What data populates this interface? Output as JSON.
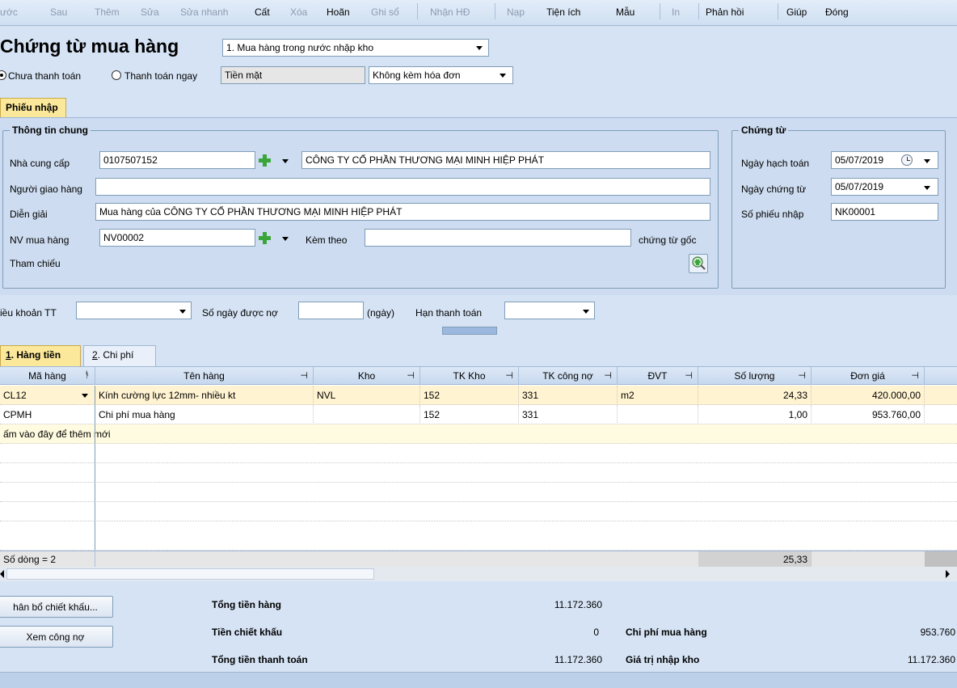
{
  "toolbar": {
    "items": [
      "ước",
      "Sau",
      "Thêm",
      "Sửa",
      "Sửa nhanh",
      "Cất",
      "Xóa",
      "Hoãn",
      "Ghi sổ",
      "Nhận HĐ",
      "Nạp",
      "Tiện ích",
      "Mẫu",
      "In",
      "Phản hồi",
      "Giúp",
      "Đóng"
    ]
  },
  "header": {
    "title": "Chứng từ mua hàng",
    "type_select": "1. Mua hàng trong nước nhập kho",
    "payment_unpaid": "Chưa thanh toán",
    "payment_now": "Thanh toán ngay",
    "payment_method": "Tiền mặt",
    "invoice_option": "Không kèm hóa đơn"
  },
  "tabs": {
    "phieu_nhap": "Phiếu nhập"
  },
  "general": {
    "group_title": "Thông tin chung",
    "supplier_label": "Nhà cung cấp",
    "supplier_code": "0107507152",
    "supplier_name": "CÔNG TY CỔ PHẦN THƯƠNG MẠI MINH HIỆP PHÁT",
    "deliverer_label": "Người giao hàng",
    "deliverer_value": "",
    "desc_label": "Diễn giải",
    "desc_value": "Mua hàng của CÔNG TY CỔ PHẦN THƯƠNG MẠI MINH HIỆP PHÁT",
    "staff_label": "NV mua hàng",
    "staff_value": "NV00002",
    "attach_label": "Kèm theo",
    "attach_value": "",
    "attach_suffix": "chứng từ gốc",
    "ref_label": "Tham chiếu"
  },
  "voucher": {
    "group_title": "Chứng từ",
    "posting_date_label": "Ngày hạch toán",
    "posting_date": "05/07/2019",
    "voucher_date_label": "Ngày chứng từ",
    "voucher_date": "05/07/2019",
    "receipt_no_label": "Số phiếu nhập",
    "receipt_no": "NK00001"
  },
  "terms": {
    "terms_label": "iều khoản TT",
    "terms_value": "",
    "credit_days_label": "Số ngày được nợ",
    "credit_days_value": "",
    "days_unit": "(ngày)",
    "due_label": "Hạn thanh toán",
    "due_value": ""
  },
  "grid_tabs": {
    "goods": "Hàng tiền",
    "goods_key": "1",
    "costs": "Chi phí",
    "costs_key": "2"
  },
  "grid": {
    "columns": [
      "Mã hàng",
      "Tên hàng",
      "Kho",
      "TK Kho",
      "TK công nợ",
      "ĐVT",
      "Số lượng",
      "Đơn giá"
    ],
    "rows": [
      [
        "CL12",
        "Kính cường lực 12mm- nhiều kt",
        "NVL",
        "152",
        "331",
        "m2",
        "24,33",
        "420.000,00"
      ],
      [
        "CPMH",
        "Chi phí mua hàng",
        "",
        "152",
        "331",
        "",
        "1,00",
        "953.760,00"
      ]
    ],
    "add_row_hint": "ấm vào đây để thêm mới",
    "row_count": "Số dòng = 2",
    "qty_total": "25,33"
  },
  "buttons": {
    "allocate_discount": "hân bổ chiết khấu...",
    "view_debt": "Xem công nợ"
  },
  "summary": {
    "total_goods_label": "Tổng tiền hàng",
    "total_goods": "11.172.360",
    "discount_label": "Tiền chiết khấu",
    "discount": "0",
    "total_pay_label": "Tổng tiền thanh toán",
    "total_pay": "11.172.360",
    "purchase_cost_label": "Chi phí mua hàng",
    "purchase_cost": "953.760",
    "stock_value_label": "Giá trị nhập kho",
    "stock_value": "11.172.360"
  },
  "colors": {
    "accent": "#fbe89a",
    "background": "#d5e3f4",
    "selected_row": "#fff3d1"
  }
}
